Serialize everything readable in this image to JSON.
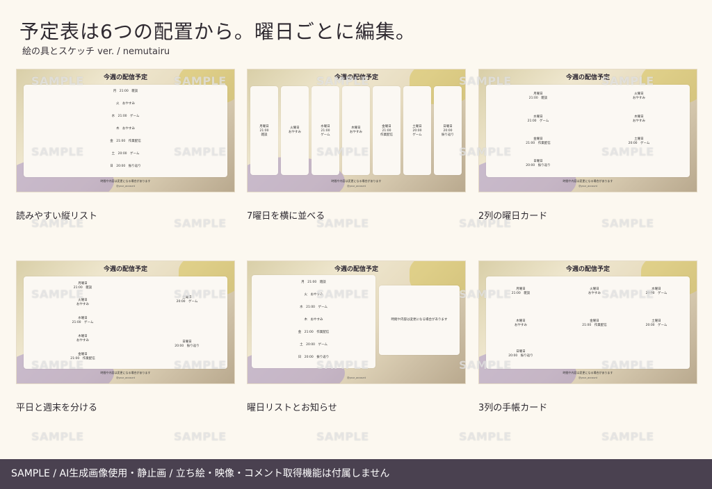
{
  "header": {
    "title": "予定表は6つの配置から。曜日ごとに編集。",
    "subtitle": "絵の具とスケッチ ver. / nemutairu"
  },
  "card_common": {
    "heading": "今週の配信予定",
    "note": "時間や内容は変更になる場合があります",
    "handle": "@your_account"
  },
  "cards": {
    "c1": {
      "caption": "読みやすい縦リスト",
      "rows": [
        "月　21:00　雑談",
        "火　おやすみ",
        "水　21:00　ゲーム",
        "木　おやすみ",
        "金　21:00　作業配信",
        "土　20:00　ゲーム",
        "日　20:00　振り返り"
      ]
    },
    "c2": {
      "caption": "7曜日を横に並べる",
      "cols": [
        {
          "l1": "月曜日",
          "l2": "21:00",
          "l3": "雑談"
        },
        {
          "l1": "火曜日",
          "l2": "おやすみ",
          "l3": ""
        },
        {
          "l1": "水曜日",
          "l2": "21:00",
          "l3": "ゲーム"
        },
        {
          "l1": "木曜日",
          "l2": "おやすみ",
          "l3": ""
        },
        {
          "l1": "金曜日",
          "l2": "21:00",
          "l3": "作業配信"
        },
        {
          "l1": "土曜日",
          "l2": "20:00",
          "l3": "ゲーム"
        },
        {
          "l1": "日曜日",
          "l2": "20:00",
          "l3": "振り返り"
        }
      ]
    },
    "c3": {
      "caption": "2列の曜日カード",
      "items": [
        {
          "day": "月曜日",
          "info": "21:00　雑談"
        },
        {
          "day": "火曜日",
          "info": "おやすみ"
        },
        {
          "day": "水曜日",
          "info": "21:00　ゲーム"
        },
        {
          "day": "木曜日",
          "info": "おやすみ"
        },
        {
          "day": "金曜日",
          "info": "21:00　作業配信"
        },
        {
          "day": "土曜日",
          "info": "20:00　ゲーム"
        },
        {
          "day": "日曜日",
          "info": "20:00　振り返り"
        }
      ]
    },
    "c4": {
      "caption": "平日と週末を分ける",
      "weekday": [
        {
          "day": "月曜日",
          "info": "21:00　雑談"
        },
        {
          "day": "火曜日",
          "info": "おやすみ"
        },
        {
          "day": "水曜日",
          "info": "21:00　ゲーム"
        },
        {
          "day": "木曜日",
          "info": "おやすみ"
        },
        {
          "day": "金曜日",
          "info": "21:00　作業配信"
        }
      ],
      "weekend": [
        {
          "day": "土曜日",
          "info": "20:00　ゲーム"
        },
        {
          "day": "日曜日",
          "info": "20:00　振り返り"
        }
      ]
    },
    "c5": {
      "caption": "曜日リストとお知らせ",
      "rows": [
        "月　21:00　雑談",
        "火　おやすみ",
        "水　21:00　ゲーム",
        "木　おやすみ",
        "金　21:00　作業配信",
        "土　20:00　ゲーム",
        "日　20:00　振り返り"
      ]
    },
    "c6": {
      "caption": "3列の手帳カード",
      "items": [
        {
          "day": "月曜日",
          "info": "21:00　雑談"
        },
        {
          "day": "火曜日",
          "info": "おやすみ"
        },
        {
          "day": "水曜日",
          "info": "20:00　ゲーム"
        },
        {
          "day": "木曜日",
          "info": "おやすみ"
        },
        {
          "day": "金曜日",
          "info": "21:00　作業配信"
        },
        {
          "day": "土曜日",
          "info": "20:00　ゲーム"
        },
        {
          "day": "日曜日",
          "info": "20:00　振り返り"
        }
      ]
    }
  },
  "watermark": "SAMPLE",
  "footer": {
    "text": "SAMPLE / AI生成画像使用・静止画 / 立ち絵・映像・コメント取得機能は付属しません"
  }
}
